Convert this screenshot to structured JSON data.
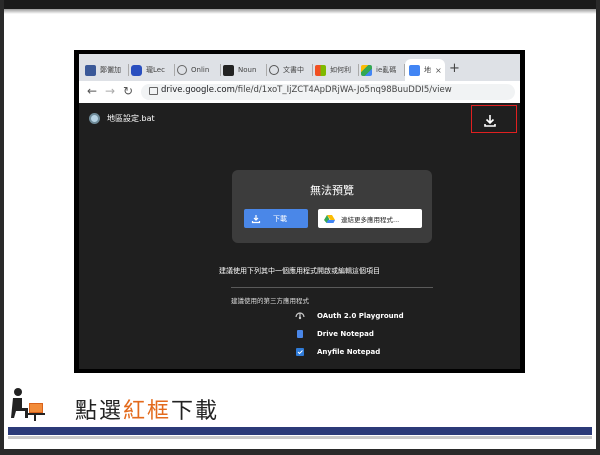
{
  "browser": {
    "tabs": [
      {
        "label": "鄭儷加",
        "color": "#3b5998"
      },
      {
        "label": "瓏Lec",
        "color": "#2a4fbf"
      },
      {
        "label": "Onlin",
        "color": "#9aa0a6"
      },
      {
        "label": "Noun",
        "color": "#222222"
      },
      {
        "label": "文書中",
        "color": "#666666"
      },
      {
        "label": "如何利",
        "color": "#f25022"
      },
      {
        "label": "ie亂碼",
        "color": "#34a853"
      },
      {
        "label": "地",
        "color": "#4285f4"
      }
    ],
    "active_tab_close": "×",
    "new_tab": "+",
    "url_host": "drive.google.com",
    "url_path": "/file/d/1xoT_IjZCT4ApDRjWA-Jo5nq98BuuDDI5/view"
  },
  "viewer": {
    "file_name": "地區設定.bat",
    "card_title": "無法預覽",
    "download_label": "下載",
    "open_with_label": "連結更多應用程式...",
    "suggest_text": "建議使用下列其中一個應用程式開啟或編輯這個項目",
    "third_party_label": "建議使用的第三方應用程式",
    "apps": [
      "OAuth 2.0 Playground",
      "Drive Notepad",
      "Anyfile Notepad"
    ],
    "accent_color": "#4a87e8",
    "highlight_color": "#e02020"
  },
  "caption": {
    "before": "點選",
    "highlight": "紅框",
    "after": "下載",
    "highlight_color": "#e36a1c"
  }
}
